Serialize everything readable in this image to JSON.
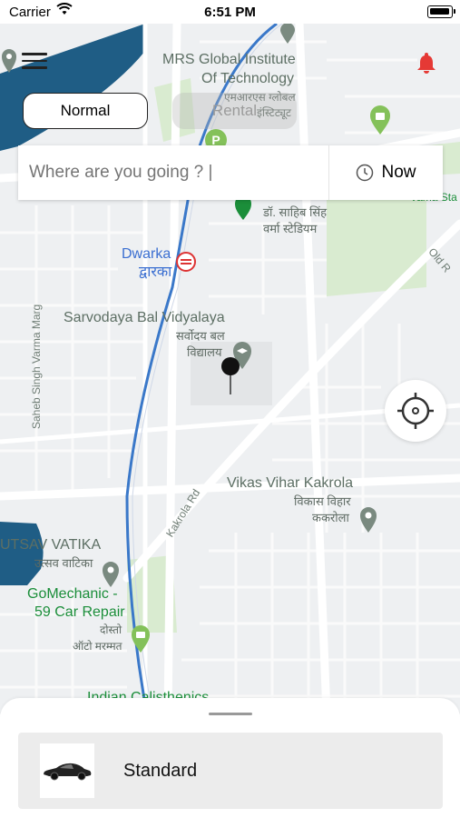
{
  "status_bar": {
    "carrier": "Carrier",
    "time": "6:51 PM"
  },
  "mode_toggle": {
    "normal_label": "Normal",
    "rental_label": "Rental"
  },
  "search": {
    "placeholder": "Where are you going ? |",
    "value": "",
    "schedule_label": "Now"
  },
  "map_labels": {
    "mrs_en_1": "MRS Global Institute",
    "mrs_en_2": "Of Technology",
    "mrs_hi_1": "एमआरएस ग्लोबल",
    "mrs_hi_2": "इंस्टिट्यूट",
    "stadium_hi_1": "डॉ. साहिब सिंह",
    "stadium_hi_2": "वर्मा स्टेडियम",
    "stadium_en": "Vama Sta",
    "dwarka_en": "Dwarka",
    "dwarka_hi": "द्वारका",
    "old_road": "Old R",
    "school_en": "Sarvodaya Bal Vidyalaya",
    "school_hi_1": "सर्वोदय बल",
    "school_hi_2": "विद्यालय",
    "marg": "Saheb Singh Varma Marg",
    "kakrola_rd": "Kakrola Rd",
    "vikas_en": "Vikas Vihar Kakrola",
    "vikas_hi_1": "विकास विहार",
    "vikas_hi_2": "ककरोला",
    "utsav_en": "UTSAV VATIKA",
    "utsav_hi": "उत्सव वाटिका",
    "gomech_1": "GoMechanic -",
    "gomech_2": "59 Car Repair",
    "gomech_hi_1": "दोस्तो",
    "gomech_hi_2": "ऑटो मरम्मत",
    "calisthenics": "Indian Calisthenics"
  },
  "ride_options": [
    {
      "label": "Standard"
    }
  ],
  "colors": {
    "water": "#1f5d85",
    "park": "#d9ebd0",
    "route": "#3a78c9",
    "bell": "#e53935",
    "poi_green": "#84c15a",
    "pin_grey": "#7a8a80"
  }
}
